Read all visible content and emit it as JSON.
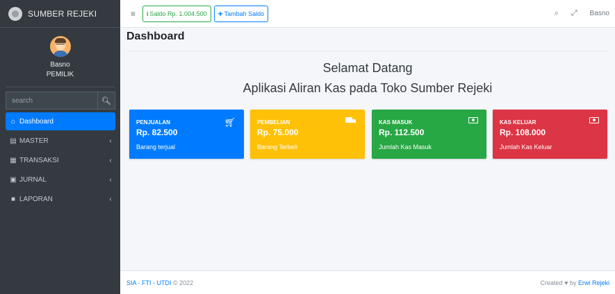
{
  "brand": {
    "name": "SUMBER REJEKI"
  },
  "user": {
    "name": "Basno",
    "role": "PEMILIK"
  },
  "sidebar": {
    "search_placeholder": "search",
    "items": [
      {
        "label": "Dashboard",
        "icon": "home-icon",
        "active": true
      },
      {
        "label": "MASTER",
        "icon": "database-icon"
      },
      {
        "label": "TRANSAKSI",
        "icon": "table-icon"
      },
      {
        "label": "JURNAL",
        "icon": "journal-icon"
      },
      {
        "label": "LAPORAN",
        "icon": "file-icon"
      }
    ]
  },
  "topbar": {
    "saldo_label": "Saldo Rp. 1.004.500",
    "tambah_label": "Tambah Saldo",
    "username": "Basno"
  },
  "page": {
    "title": "Dashboard",
    "welcome_line1": "Selamat Datang",
    "welcome_line2": "Aplikasi Aliran Kas pada Toko Sumber Rejeki"
  },
  "boxes": [
    {
      "label": "PENJUALAN",
      "value": "Rp. 82.500",
      "sub": "Barang terjual",
      "color": "#007bff",
      "icon": "shopping-cart-icon"
    },
    {
      "label": "PEMBELIAN",
      "value": "Rp. 75.000",
      "sub": "Barang Terbeli",
      "color": "#ffc107",
      "icon": "truck-icon"
    },
    {
      "label": "KAS MASUK",
      "value": "Rp. 112.500",
      "sub": "Jumlah Kas Masuk",
      "color": "#28a745",
      "icon": "money-bill-icon"
    },
    {
      "label": "KAS KELUAR",
      "value": "Rp. 108.000",
      "sub": "Jumlah Kas Keluar",
      "color": "#dc3545",
      "icon": "money-bill-icon"
    }
  ],
  "footer": {
    "left_link": "SIA - FTI - UTDI",
    "left_text": "© 2022",
    "right_prefix": "Created",
    "right_mid": "by",
    "right_link": "Erwi Rejeki"
  }
}
